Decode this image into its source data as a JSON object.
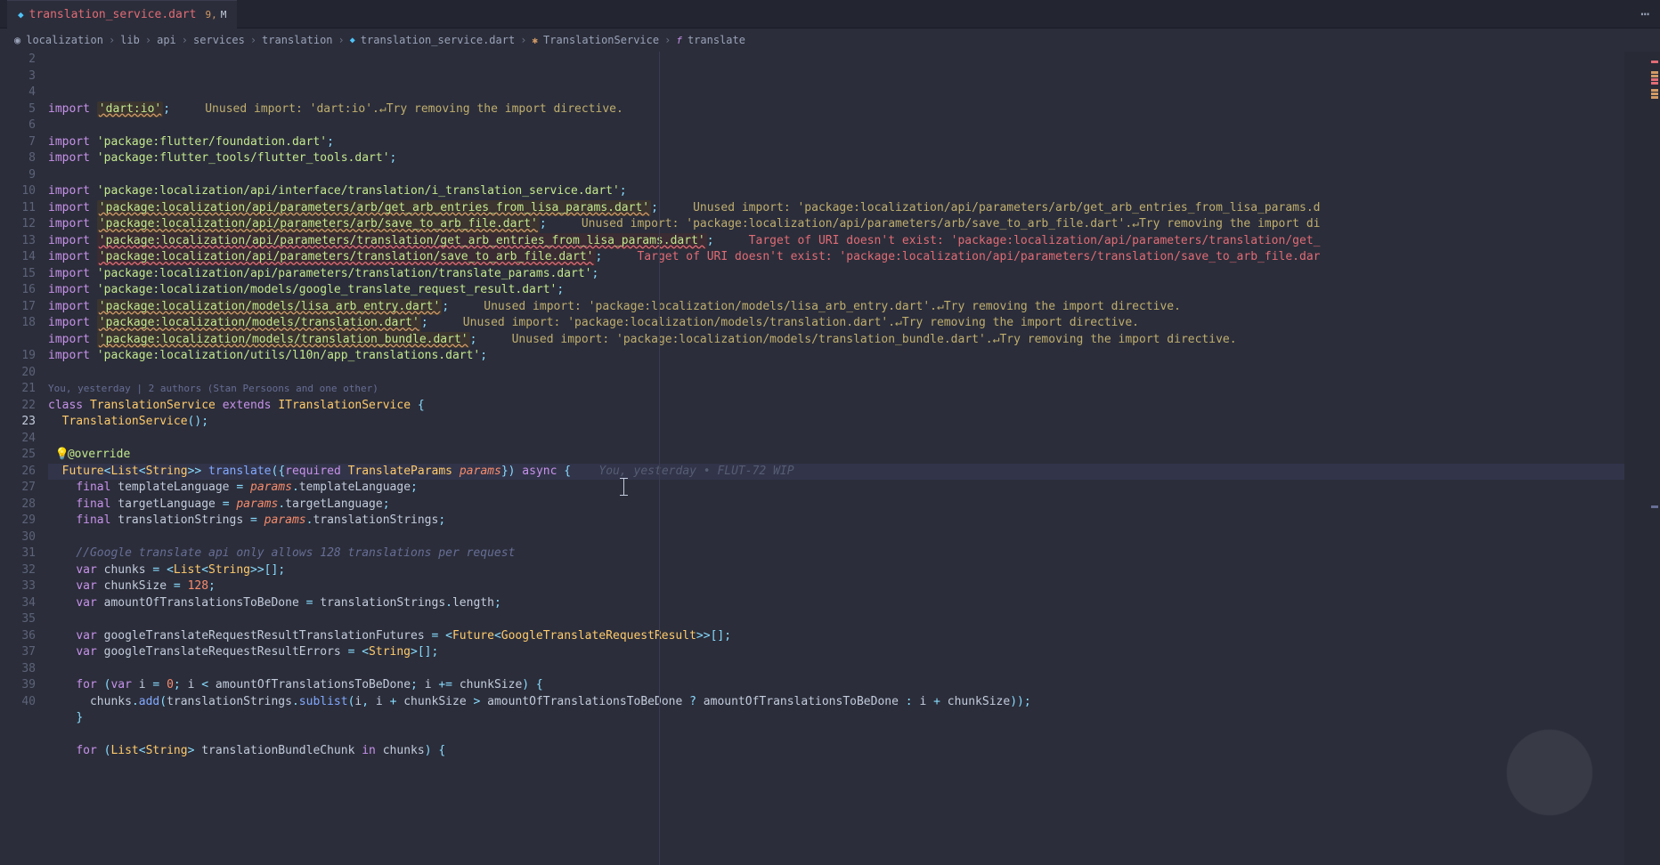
{
  "tab": {
    "filename": "translation_service.dart",
    "problem_count": "9,",
    "modified": "M"
  },
  "breadcrumbs": {
    "p0": "localization",
    "p1": "lib",
    "p2": "api",
    "p3": "services",
    "p4": "translation",
    "file": "translation_service.dart",
    "sym_class": "TranslationService",
    "sym_method": "translate"
  },
  "gutter": {
    "start": 2,
    "end": 40,
    "active": 23
  },
  "code": {
    "l2": {
      "pre": "import ",
      "str": "'dart:io'",
      "post": ";",
      "hint": "     Unused import: 'dart:io'.↵Try removing the import directive."
    },
    "l4": {
      "pre": "import ",
      "str": "'package:flutter/foundation.dart'",
      "post": ";"
    },
    "l5": {
      "pre": "import ",
      "str": "'package:flutter_tools/flutter_tools.dart'",
      "post": ";"
    },
    "l7": {
      "pre": "import ",
      "str": "'package:localization/api/interface/translation/i_translation_service.dart'",
      "post": ";"
    },
    "l8": {
      "pre": "import ",
      "str": "'package:localization/api/parameters/arb/get_arb_entries_from_lisa_params.dart'",
      "post": ";",
      "hint": "     Unused import: 'package:localization/api/parameters/arb/get_arb_entries_from_lisa_params.d"
    },
    "l9": {
      "pre": "import ",
      "str": "'package:localization/api/parameters/arb/save_to_arb_file.dart'",
      "post": ";",
      "hint": "     Unused import: 'package:localization/api/parameters/arb/save_to_arb_file.dart'.↵Try removing the import di"
    },
    "l10": {
      "pre": "import ",
      "str": "'package:localization/api/parameters/translation/get_arb_entries_from_lisa_params.dart'",
      "post": ";",
      "err": "     Target of URI doesn't exist: 'package:localization/api/parameters/translation/get_"
    },
    "l11": {
      "pre": "import ",
      "str": "'package:localization/api/parameters/translation/save_to_arb_file.dart'",
      "post": ";",
      "err": "     Target of URI doesn't exist: 'package:localization/api/parameters/translation/save_to_arb_file.dar"
    },
    "l12": {
      "pre": "import ",
      "str": "'package:localization/api/parameters/translation/translate_params.dart'",
      "post": ";"
    },
    "l13": {
      "pre": "import ",
      "str": "'package:localization/models/google_translate_request_result.dart'",
      "post": ";"
    },
    "l14": {
      "pre": "import ",
      "str": "'package:localization/models/lisa_arb_entry.dart'",
      "post": ";",
      "hint": "     Unused import: 'package:localization/models/lisa_arb_entry.dart'.↵Try removing the import directive."
    },
    "l15": {
      "pre": "import ",
      "str": "'package:localization/models/translation.dart'",
      "post": ";",
      "hint": "     Unused import: 'package:localization/models/translation.dart'.↵Try removing the import directive."
    },
    "l16": {
      "pre": "import ",
      "str": "'package:localization/models/translation_bundle.dart'",
      "post": ";",
      "hint": "     Unused import: 'package:localization/models/translation_bundle.dart'.↵Try removing the import directive."
    },
    "l17": {
      "pre": "import ",
      "str": "'package:localization/utils/l10n/app_translations.dart'",
      "post": ";"
    },
    "lens": "You, yesterday | 2 authors (Stan Persoons and one other)",
    "l19": "class TranslationService extends ITranslationService {",
    "l20": "  TranslationService();",
    "l22": "  @override",
    "l23": "  Future<List<String>> translate({required TranslateParams params}) async {",
    "l23_blame": "    You, yesterday • FLUT-72 WIP",
    "l24": "    final templateLanguage = params.templateLanguage;",
    "l25": "    final targetLanguage = params.targetLanguage;",
    "l26": "    final translationStrings = params.translationStrings;",
    "l28": "    //Google translate api only allows 128 translations per request",
    "l29": "    var chunks = <List<String>>[];",
    "l30": "    var chunkSize = 128;",
    "l31": "    var amountOfTranslationsToBeDone = translationStrings.length;",
    "l33": "    var googleTranslateRequestResultTranslationFutures = <Future<GoogleTranslateRequestResult>>[];",
    "l34": "    var googleTranslateRequestResultErrors = <String>[];",
    "l36": "    for (var i = 0; i < amountOfTranslationsToBeDone; i += chunkSize) {",
    "l37": "      chunks.add(translationStrings.sublist(i, i + chunkSize > amountOfTranslationsToBeDone ? amountOfTranslationsToBeDone : i + chunkSize));",
    "l38": "    }",
    "l40": "    for (List<String> translationBundleChunk in chunks) {"
  }
}
